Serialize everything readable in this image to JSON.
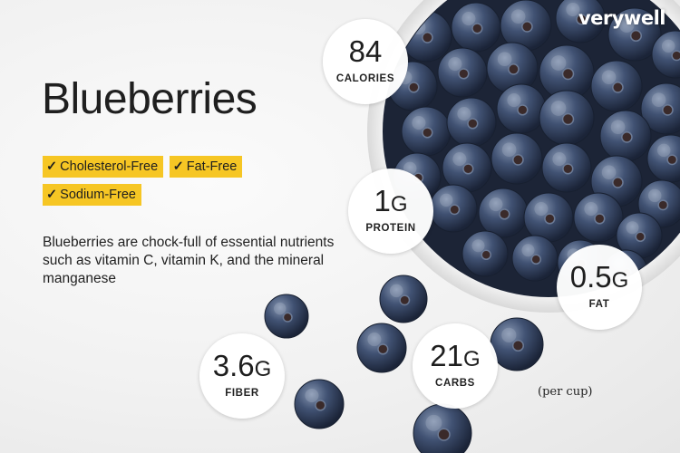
{
  "brand": "verywell",
  "title": "Blueberries",
  "tags": [
    "Cholesterol-Free",
    "Fat-Free",
    "Sodium-Free"
  ],
  "check_icon": "checkmark-icon",
  "description": "Blueberries are chock-full of essential nutrients such as vitamin C, vitamin K, and the mineral manganese",
  "nutrition": {
    "calories": {
      "value": "84",
      "unit": "",
      "label": "CALORIES"
    },
    "protein": {
      "value": "1",
      "unit": "G",
      "label": "PROTEIN"
    },
    "fat": {
      "value": "0.5",
      "unit": "G",
      "label": "FAT"
    },
    "fiber": {
      "value": "3.6",
      "unit": "G",
      "label": "FIBER"
    },
    "carbs": {
      "value": "21",
      "unit": "G",
      "label": "CARBS"
    }
  },
  "serving_note": "(per cup)",
  "colors": {
    "tag_background": "#f6c624",
    "badge_background": "#ffffff",
    "text": "#1e1e1e",
    "berry": "#2f3e5c"
  }
}
